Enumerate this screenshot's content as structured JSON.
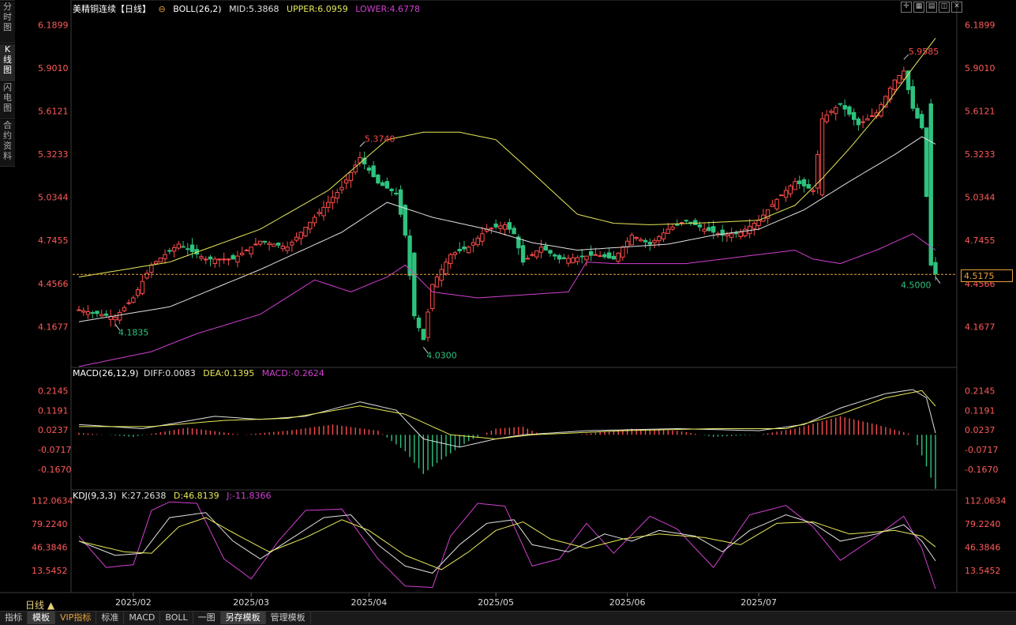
{
  "left_tabs": [
    "分时图",
    "K线图",
    "闪电图",
    "合约资料"
  ],
  "active_tab": 1,
  "main_title": {
    "symbol": "美精铜连续【日线】",
    "boll": "BOLL(26,2)",
    "mid": "MID:5.3868",
    "upper": "UPPER:6.0959",
    "lower": "LOWER:4.6778"
  },
  "macd_title": {
    "name": "MACD(26,12,9)",
    "diff": "DIFF:0.0083",
    "dea": "DEA:0.1395",
    "macd": "MACD:-0.2624"
  },
  "kdj_title": {
    "name": "KDJ(9,3,3)",
    "k": "K:27.2638",
    "d": "D:46.8139",
    "j": "J:-11.8366"
  },
  "current_price": "4.5175",
  "period_label": "日线 ▲",
  "bottom_tabs": [
    "指标",
    "模板",
    "VIP指标",
    "标准",
    "MACD",
    "BOLL",
    "一图",
    "另存模板",
    "管理模板"
  ],
  "colors": {
    "up": "#ff4b4b",
    "down": "#2ec27e",
    "mid": "#e0e0e0",
    "upper": "#e8e85a",
    "lower": "#d040d0",
    "dea": "#e8e85a",
    "j": "#d040d0",
    "axis": "#ff5a5a",
    "tag": "#e8a33c"
  },
  "chart_data": [
    {
      "type": "candlestick",
      "y_ticks": [
        6.1899,
        5.901,
        5.6121,
        5.3233,
        5.0344,
        4.7455,
        4.4566,
        4.1677
      ],
      "ylim": [
        4.0,
        6.25
      ],
      "x_labels": [
        "2025/02",
        "2025/03",
        "2025/04",
        "2025/05",
        "2025/06",
        "2025/07"
      ],
      "annotations": [
        {
          "label": "4.1835",
          "value": 4.1835,
          "kind": "low",
          "color": "green"
        },
        {
          "label": "5.3740",
          "value": 5.374,
          "kind": "high",
          "color": "red"
        },
        {
          "label": "4.0300",
          "value": 4.03,
          "kind": "low",
          "color": "green"
        },
        {
          "label": "5.9585",
          "value": 5.9585,
          "kind": "high",
          "color": "red"
        },
        {
          "label": "4.5000",
          "value": 4.5,
          "kind": "low",
          "color": "green"
        }
      ],
      "key_points": [
        [
          0,
          4.28
        ],
        [
          8,
          4.23
        ],
        [
          12,
          4.36
        ],
        [
          16,
          4.58
        ],
        [
          22,
          4.72
        ],
        [
          28,
          4.62
        ],
        [
          34,
          4.62
        ],
        [
          40,
          4.74
        ],
        [
          46,
          4.7
        ],
        [
          52,
          4.9
        ],
        [
          58,
          5.1
        ],
        [
          62,
          5.3
        ],
        [
          66,
          5.13
        ],
        [
          70,
          5.06
        ],
        [
          72,
          4.78
        ],
        [
          74,
          4.24
        ],
        [
          76,
          4.08
        ],
        [
          78,
          4.45
        ],
        [
          82,
          4.65
        ],
        [
          86,
          4.7
        ],
        [
          90,
          4.82
        ],
        [
          94,
          4.85
        ],
        [
          96,
          4.79
        ],
        [
          98,
          4.6
        ],
        [
          102,
          4.7
        ],
        [
          106,
          4.62
        ],
        [
          110,
          4.63
        ],
        [
          114,
          4.65
        ],
        [
          118,
          4.62
        ],
        [
          122,
          4.78
        ],
        [
          126,
          4.72
        ],
        [
          130,
          4.82
        ],
        [
          134,
          4.88
        ],
        [
          138,
          4.82
        ],
        [
          142,
          4.78
        ],
        [
          146,
          4.8
        ],
        [
          150,
          4.88
        ],
        [
          154,
          5.02
        ],
        [
          158,
          5.14
        ],
        [
          162,
          5.08
        ],
        [
          164,
          5.56
        ],
        [
          168,
          5.66
        ],
        [
          172,
          5.52
        ],
        [
          176,
          5.6
        ],
        [
          180,
          5.82
        ],
        [
          182,
          5.88
        ],
        [
          184,
          5.63
        ],
        [
          186,
          5.5
        ],
        [
          188,
          4.58
        ],
        [
          189,
          4.52
        ]
      ],
      "boll_mid": [
        [
          0,
          4.2
        ],
        [
          20,
          4.3
        ],
        [
          40,
          4.55
        ],
        [
          58,
          4.8
        ],
        [
          68,
          5.0
        ],
        [
          78,
          4.9
        ],
        [
          90,
          4.82
        ],
        [
          100,
          4.73
        ],
        [
          110,
          4.68
        ],
        [
          120,
          4.7
        ],
        [
          130,
          4.72
        ],
        [
          140,
          4.78
        ],
        [
          150,
          4.82
        ],
        [
          160,
          4.95
        ],
        [
          170,
          5.14
        ],
        [
          180,
          5.32
        ],
        [
          186,
          5.44
        ],
        [
          189,
          5.39
        ]
      ],
      "boll_upper": [
        [
          0,
          4.5
        ],
        [
          20,
          4.6
        ],
        [
          40,
          4.82
        ],
        [
          55,
          5.08
        ],
        [
          68,
          5.42
        ],
        [
          76,
          5.47
        ],
        [
          84,
          5.47
        ],
        [
          92,
          5.42
        ],
        [
          100,
          5.2
        ],
        [
          110,
          4.92
        ],
        [
          118,
          4.86
        ],
        [
          126,
          4.85
        ],
        [
          136,
          4.86
        ],
        [
          150,
          4.88
        ],
        [
          158,
          4.98
        ],
        [
          164,
          5.16
        ],
        [
          170,
          5.36
        ],
        [
          178,
          5.65
        ],
        [
          184,
          5.9
        ],
        [
          189,
          6.1
        ]
      ],
      "boll_lower": [
        [
          0,
          3.9
        ],
        [
          16,
          4.0
        ],
        [
          26,
          4.12
        ],
        [
          40,
          4.25
        ],
        [
          52,
          4.48
        ],
        [
          60,
          4.4
        ],
        [
          68,
          4.5
        ],
        [
          72,
          4.58
        ],
        [
          78,
          4.4
        ],
        [
          88,
          4.36
        ],
        [
          98,
          4.38
        ],
        [
          108,
          4.4
        ],
        [
          112,
          4.6
        ],
        [
          118,
          4.59
        ],
        [
          134,
          4.59
        ],
        [
          150,
          4.65
        ],
        [
          158,
          4.68
        ],
        [
          162,
          4.62
        ],
        [
          168,
          4.59
        ],
        [
          176,
          4.68
        ],
        [
          184,
          4.79
        ],
        [
          189,
          4.68
        ]
      ]
    },
    {
      "type": "histogram_line",
      "y_ticks": [
        0.2145,
        0.1191,
        0.0237,
        -0.0717,
        -0.167
      ],
      "ylim": [
        -0.26,
        0.27
      ],
      "diff": [
        [
          0,
          0.05
        ],
        [
          14,
          0.03
        ],
        [
          30,
          0.09
        ],
        [
          40,
          0.075
        ],
        [
          50,
          0.09
        ],
        [
          62,
          0.16
        ],
        [
          70,
          0.12
        ],
        [
          76,
          -0.02
        ],
        [
          84,
          -0.06
        ],
        [
          92,
          -0.02
        ],
        [
          98,
          0.0
        ],
        [
          112,
          0.02
        ],
        [
          132,
          0.03
        ],
        [
          150,
          0.02
        ],
        [
          160,
          0.05
        ],
        [
          168,
          0.13
        ],
        [
          178,
          0.2
        ],
        [
          184,
          0.22
        ],
        [
          187,
          0.18
        ],
        [
          189,
          0.0083
        ]
      ],
      "dea": [
        [
          0,
          0.04
        ],
        [
          16,
          0.04
        ],
        [
          32,
          0.07
        ],
        [
          46,
          0.08
        ],
        [
          62,
          0.14
        ],
        [
          72,
          0.1
        ],
        [
          82,
          0.0
        ],
        [
          92,
          -0.02
        ],
        [
          100,
          0.0
        ],
        [
          120,
          0.02
        ],
        [
          140,
          0.03
        ],
        [
          156,
          0.03
        ],
        [
          168,
          0.1
        ],
        [
          178,
          0.18
        ],
        [
          186,
          0.215
        ],
        [
          189,
          0.1395
        ]
      ],
      "hist": [
        [
          0,
          0.01
        ],
        [
          12,
          -0.01
        ],
        [
          24,
          0.035
        ],
        [
          36,
          0.0
        ],
        [
          46,
          0.02
        ],
        [
          56,
          0.05
        ],
        [
          66,
          0.02
        ],
        [
          72,
          -0.08
        ],
        [
          76,
          -0.19
        ],
        [
          80,
          -0.12
        ],
        [
          86,
          -0.03
        ],
        [
          92,
          0.03
        ],
        [
          98,
          0.04
        ],
        [
          102,
          0.0
        ],
        [
          110,
          0.0
        ],
        [
          122,
          0.03
        ],
        [
          132,
          0.02
        ],
        [
          140,
          -0.01
        ],
        [
          150,
          0.0
        ],
        [
          158,
          0.03
        ],
        [
          168,
          0.09
        ],
        [
          176,
          0.05
        ],
        [
          184,
          0.0
        ],
        [
          186,
          -0.1
        ],
        [
          189,
          -0.2624
        ]
      ]
    },
    {
      "type": "line",
      "y_ticks": [
        112.0634,
        79.224,
        46.3846,
        13.5452
      ],
      "ylim": [
        -15,
        118
      ],
      "k": [
        [
          0,
          55
        ],
        [
          8,
          35
        ],
        [
          14,
          38
        ],
        [
          20,
          88
        ],
        [
          28,
          95
        ],
        [
          34,
          55
        ],
        [
          40,
          30
        ],
        [
          46,
          55
        ],
        [
          54,
          88
        ],
        [
          60,
          92
        ],
        [
          66,
          50
        ],
        [
          72,
          20
        ],
        [
          78,
          10
        ],
        [
          84,
          50
        ],
        [
          90,
          80
        ],
        [
          96,
          85
        ],
        [
          100,
          50
        ],
        [
          108,
          40
        ],
        [
          116,
          65
        ],
        [
          122,
          55
        ],
        [
          128,
          70
        ],
        [
          136,
          62
        ],
        [
          142,
          40
        ],
        [
          148,
          70
        ],
        [
          156,
          92
        ],
        [
          162,
          80
        ],
        [
          168,
          55
        ],
        [
          176,
          65
        ],
        [
          182,
          78
        ],
        [
          186,
          55
        ],
        [
          189,
          27.2638
        ]
      ],
      "d": [
        [
          0,
          55
        ],
        [
          10,
          40
        ],
        [
          16,
          38
        ],
        [
          22,
          75
        ],
        [
          28,
          88
        ],
        [
          36,
          60
        ],
        [
          42,
          40
        ],
        [
          50,
          60
        ],
        [
          58,
          85
        ],
        [
          64,
          70
        ],
        [
          72,
          35
        ],
        [
          80,
          15
        ],
        [
          86,
          40
        ],
        [
          92,
          70
        ],
        [
          98,
          82
        ],
        [
          104,
          58
        ],
        [
          112,
          45
        ],
        [
          120,
          58
        ],
        [
          128,
          65
        ],
        [
          138,
          60
        ],
        [
          146,
          50
        ],
        [
          154,
          80
        ],
        [
          162,
          82
        ],
        [
          170,
          65
        ],
        [
          180,
          70
        ],
        [
          186,
          62
        ],
        [
          189,
          46.8139
        ]
      ],
      "j": [
        [
          0,
          62
        ],
        [
          6,
          18
        ],
        [
          12,
          22
        ],
        [
          16,
          98
        ],
        [
          20,
          110
        ],
        [
          26,
          108
        ],
        [
          32,
          30
        ],
        [
          38,
          2
        ],
        [
          44,
          55
        ],
        [
          50,
          98
        ],
        [
          58,
          100
        ],
        [
          66,
          30
        ],
        [
          72,
          -8
        ],
        [
          78,
          -10
        ],
        [
          82,
          62
        ],
        [
          88,
          108
        ],
        [
          94,
          104
        ],
        [
          100,
          20
        ],
        [
          106,
          30
        ],
        [
          112,
          80
        ],
        [
          118,
          38
        ],
        [
          126,
          90
        ],
        [
          132,
          72
        ],
        [
          140,
          18
        ],
        [
          148,
          92
        ],
        [
          156,
          105
        ],
        [
          162,
          75
        ],
        [
          168,
          28
        ],
        [
          176,
          62
        ],
        [
          182,
          90
        ],
        [
          186,
          45
        ],
        [
          189,
          -11.8366
        ]
      ]
    }
  ]
}
